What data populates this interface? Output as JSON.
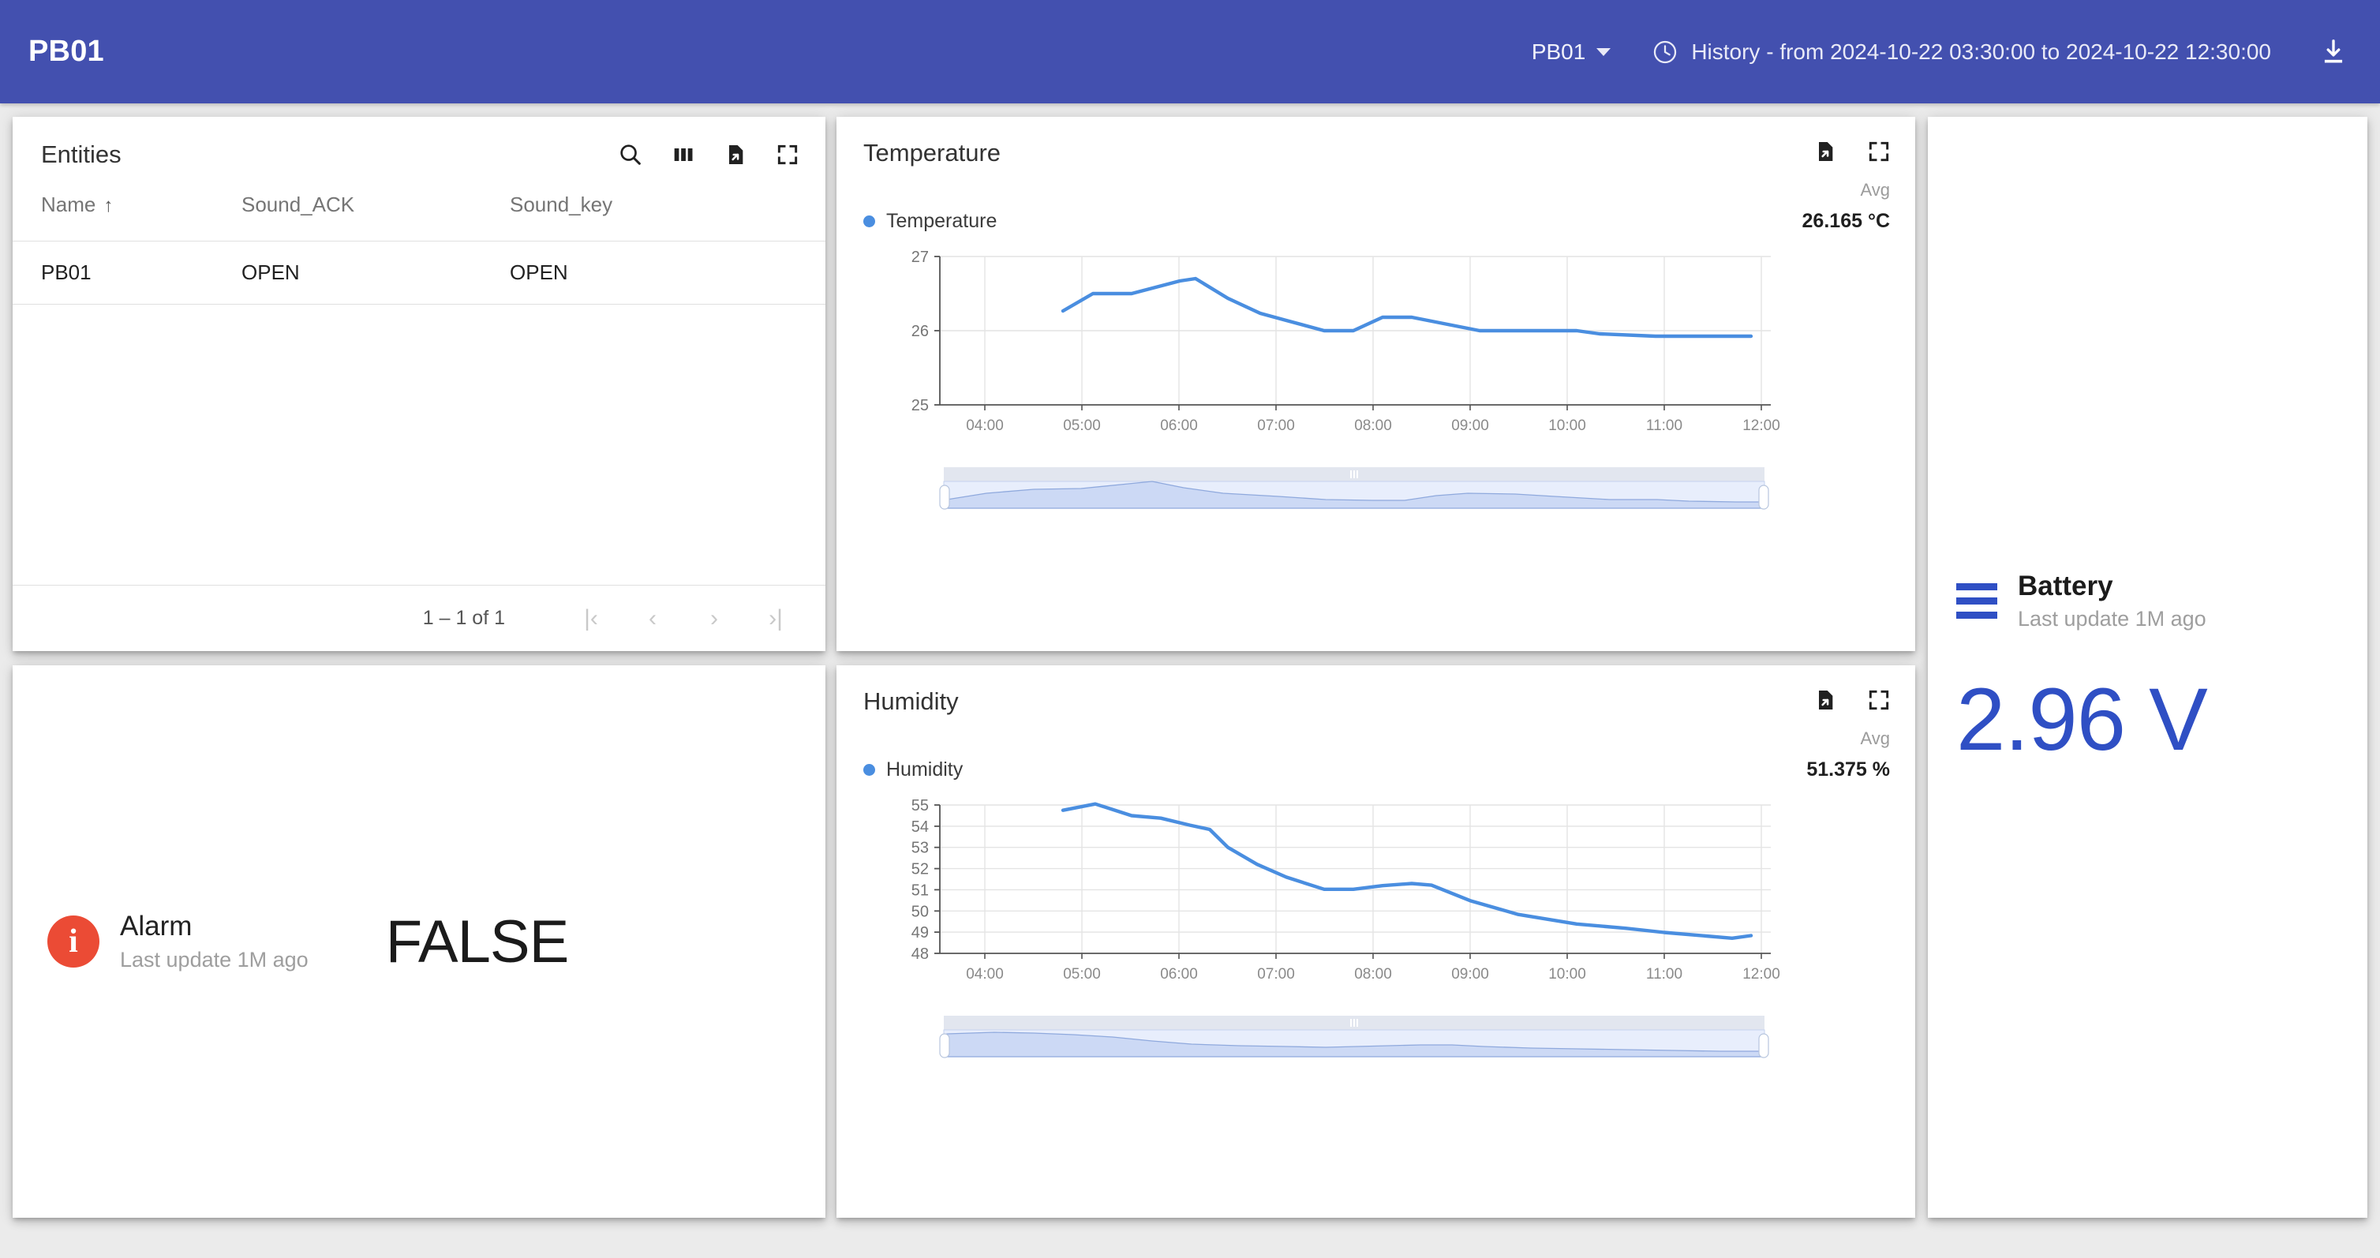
{
  "appbar": {
    "title": "PB01",
    "entity_selector": {
      "label": "PB01",
      "icon": "chevron-down-icon"
    },
    "timewindow": {
      "icon": "clock-icon",
      "label": "History - from 2024-10-22 03:30:00 to 2024-10-22 12:30:00"
    },
    "download_icon": "download-icon",
    "background": "#4350af"
  },
  "entities_card": {
    "title": "Entities",
    "icons": [
      "search-icon",
      "columns-icon",
      "export-file-icon",
      "fullscreen-icon"
    ],
    "columns": [
      "Name",
      "Sound_ACK",
      "Sound_key"
    ],
    "sort_column": "Name",
    "sort_direction": "asc",
    "rows": [
      {
        "name": "PB01",
        "sound_ack": "OPEN",
        "sound_key": "OPEN"
      }
    ],
    "paginator": {
      "range": "1 – 1 of 1",
      "first": "|‹",
      "prev": "‹",
      "next": "›",
      "last": "›|"
    }
  },
  "alarm_card": {
    "icon": "info-icon",
    "icon_glyph": "i",
    "icon_color": "#eb4b35",
    "label": "Alarm",
    "subtitle": "Last update 1M ago",
    "value": "FALSE"
  },
  "battery_card": {
    "icon": "battery-bars-icon",
    "icon_color": "#2f4fc4",
    "label": "Battery",
    "subtitle": "Last update 1M ago",
    "value": "2.96 V",
    "value_color": "#2f4fc4"
  },
  "temperature_card": {
    "title": "Temperature",
    "icons": [
      "export-file-icon",
      "fullscreen-icon"
    ],
    "agg_label": "Avg",
    "series_label": "Temperature",
    "series_value": "26.165 °C",
    "series_color": "#4a8ee0"
  },
  "humidity_card": {
    "title": "Humidity",
    "icons": [
      "export-file-icon",
      "fullscreen-icon"
    ],
    "agg_label": "Avg",
    "series_label": "Humidity",
    "series_value": "51.375 %",
    "series_color": "#4a8ee0"
  },
  "chart_data": [
    {
      "id": "temperature",
      "type": "line",
      "title": "Temperature",
      "xlabel": "",
      "ylabel": "°C",
      "unit": "°C",
      "aggregation": "Avg",
      "avg": 26.165,
      "xlim": [
        "03:30",
        "12:30"
      ],
      "ylim": [
        25,
        27
      ],
      "yticks": [
        25,
        26,
        27
      ],
      "xticks": [
        "04:00",
        "05:00",
        "06:00",
        "07:00",
        "08:00",
        "09:00",
        "10:00",
        "11:00",
        "12:00"
      ],
      "grid": true,
      "legend_position": "top-left",
      "series": [
        {
          "name": "Temperature",
          "color": "#4a8ee0",
          "x": [
            "04:48",
            "05:06",
            "05:30",
            "06:00",
            "06:10",
            "06:30",
            "06:50",
            "07:06",
            "07:30",
            "07:48",
            "08:06",
            "08:24",
            "09:06",
            "10:06",
            "10:30",
            "11:06",
            "11:30",
            "12:06"
          ],
          "values": [
            26.27,
            26.5,
            26.5,
            26.67,
            26.7,
            26.44,
            26.23,
            26.14,
            26.0,
            26.0,
            26.18,
            26.18,
            26.0,
            26.0,
            25.96,
            25.93,
            25.93,
            25.93
          ]
        }
      ],
      "navigator": {
        "visible": true,
        "range_start": 0.0,
        "range_end": 1.0
      }
    },
    {
      "id": "humidity",
      "type": "line",
      "title": "Humidity",
      "xlabel": "",
      "ylabel": "%",
      "unit": "%",
      "aggregation": "Avg",
      "avg": 51.375,
      "xlim": [
        "03:30",
        "12:30"
      ],
      "ylim": [
        48,
        55
      ],
      "yticks": [
        48,
        49,
        50,
        51,
        52,
        53,
        54,
        55
      ],
      "xticks": [
        "04:00",
        "05:00",
        "06:00",
        "07:00",
        "08:00",
        "09:00",
        "10:00",
        "11:00",
        "12:00"
      ],
      "grid": true,
      "legend_position": "top-left",
      "series": [
        {
          "name": "Humidity",
          "color": "#4a8ee0",
          "x": [
            "04:48",
            "05:08",
            "05:30",
            "05:48",
            "06:06",
            "06:18",
            "06:30",
            "06:48",
            "07:06",
            "07:30",
            "07:48",
            "08:06",
            "08:24",
            "08:36",
            "09:00",
            "09:30",
            "10:06",
            "10:36",
            "11:06",
            "11:48",
            "12:06"
          ],
          "values": [
            54.75,
            55.05,
            54.5,
            54.38,
            54.05,
            53.85,
            53.0,
            52.2,
            51.6,
            51.03,
            51.03,
            51.2,
            51.3,
            51.22,
            50.55,
            49.9,
            49.45,
            49.25,
            49.05,
            48.78,
            48.9
          ]
        }
      ],
      "navigator": {
        "visible": true,
        "range_start": 0.0,
        "range_end": 1.0
      }
    }
  ]
}
